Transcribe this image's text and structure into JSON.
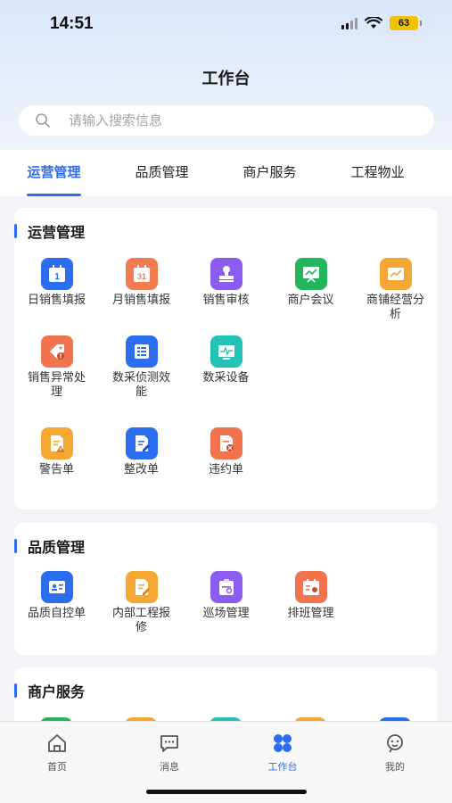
{
  "status": {
    "time": "14:51",
    "battery": "63"
  },
  "header": {
    "title": "工作台"
  },
  "search": {
    "placeholder": "请输入搜索信息"
  },
  "tabs": [
    {
      "label": "运营管理",
      "active": true
    },
    {
      "label": "品质管理",
      "active": false
    },
    {
      "label": "商户服务",
      "active": false
    },
    {
      "label": "工程物业",
      "active": false
    }
  ],
  "sections": {
    "operations": {
      "title": "运营管理",
      "items": [
        {
          "label": "日销售填报",
          "icon": "calendar-day-icon",
          "color": "#2b6ff0"
        },
        {
          "label": "月销售填报",
          "icon": "calendar-month-icon",
          "color": "#f47b4f"
        },
        {
          "label": "销售审核",
          "icon": "stamp-icon",
          "color": "#8a5cf0"
        },
        {
          "label": "商户会议",
          "icon": "presentation-icon",
          "color": "#23b55c"
        },
        {
          "label": "商铺经营分析",
          "icon": "analysis-chart-icon",
          "color": "#f5a733"
        },
        {
          "label": "销售异常处理",
          "icon": "tag-alert-icon",
          "color": "#f2744f"
        },
        {
          "label": "数采侦测效能",
          "icon": "data-list-icon",
          "color": "#2b6ff0"
        },
        {
          "label": "数采设备",
          "icon": "monitor-pulse-icon",
          "color": "#22c3b6"
        },
        {
          "label": "警告单",
          "icon": "warning-doc-icon",
          "color": "#f5a733"
        },
        {
          "label": "整改单",
          "icon": "edit-doc-icon",
          "color": "#2b6ff0"
        },
        {
          "label": "违约单",
          "icon": "breach-doc-icon",
          "color": "#f2744f"
        }
      ]
    },
    "quality": {
      "title": "品质管理",
      "items": [
        {
          "label": "品质自控单",
          "icon": "id-card-icon",
          "color": "#2b6ff0"
        },
        {
          "label": "内部工程报修",
          "icon": "repair-doc-icon",
          "color": "#f5a733"
        },
        {
          "label": "巡场管理",
          "icon": "patrol-clipboard-icon",
          "color": "#8a5cf0"
        },
        {
          "label": "排班管理",
          "icon": "schedule-icon",
          "color": "#f2744f"
        }
      ]
    },
    "merchant": {
      "title": "商户服务",
      "icon_colors": [
        "#23b55c",
        "#f5a733",
        "#22c3b6",
        "#f5a733",
        "#2b6ff0"
      ]
    }
  },
  "bottom_nav": [
    {
      "label": "首页",
      "icon": "home-icon",
      "active": false
    },
    {
      "label": "消息",
      "icon": "message-icon",
      "active": false
    },
    {
      "label": "工作台",
      "icon": "workbench-icon",
      "active": true
    },
    {
      "label": "我的",
      "icon": "profile-icon",
      "active": false
    }
  ]
}
